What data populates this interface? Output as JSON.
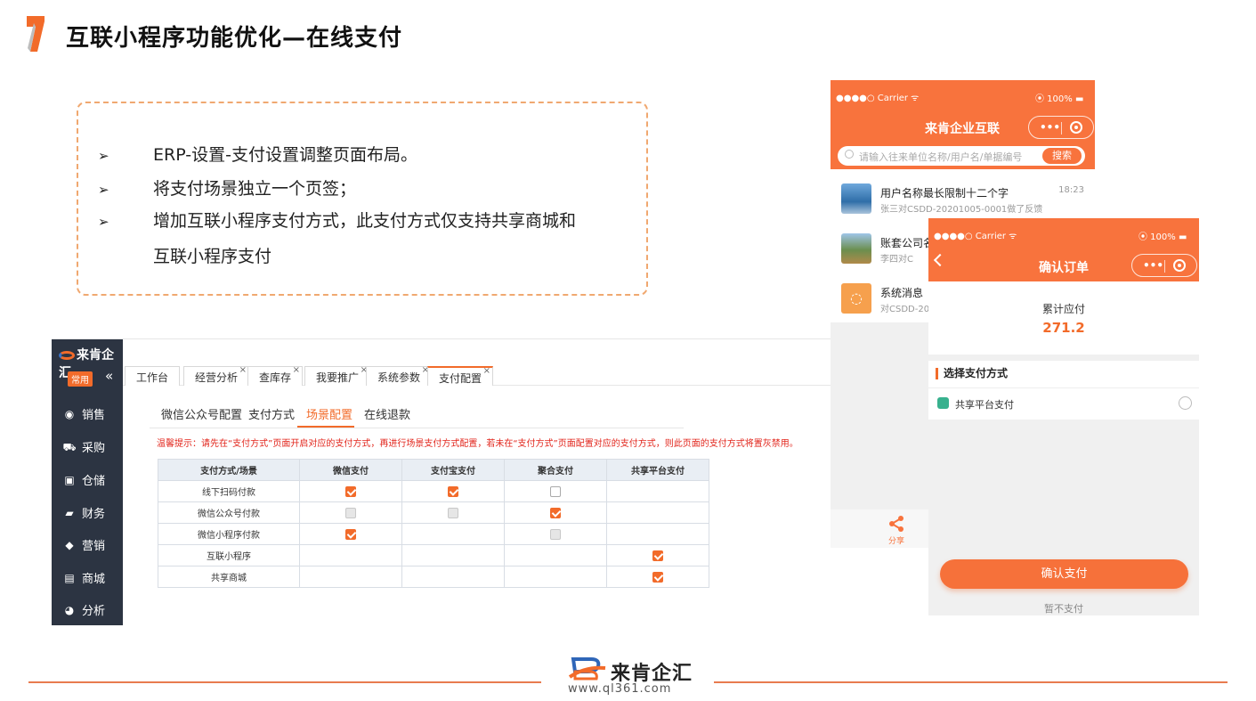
{
  "slide": {
    "title": "互联小程序功能优化—在线支付",
    "bullets": [
      "ERP-设置-支付设置调整页面布局。",
      "将支付场景独立一个页签；",
      "增加互联小程序支付方式，此支付方式仅支持共享商城和",
      "互联小程序支付"
    ],
    "bullet_marker": "➢"
  },
  "erp": {
    "logo": "来肯企汇",
    "common_badge": "常用",
    "collapse_glyph": "«",
    "menu": [
      "销售",
      "采购",
      "仓储",
      "财务",
      "营销",
      "商城",
      "分析"
    ],
    "page_tabs": [
      "工作台",
      "经营分析",
      "查库存",
      "我要推广",
      "系统参数",
      "支付配置"
    ],
    "active_page_tab": "支付配置",
    "close_glyph": "×",
    "sub_tabs": [
      "微信公众号配置",
      "支付方式",
      "场景配置",
      "在线退款"
    ],
    "active_sub_tab": "场景配置",
    "warning": "温馨提示：请先在“支付方式”页面开启对应的支付方式，再进行场景支付方式配置，若未在“支付方式”页面配置对应的支付方式，则此页面的支付方式将置灰禁用。",
    "table": {
      "headers": [
        "支付方式/场景",
        "微信支付",
        "支付宝支付",
        "聚合支付",
        "共享平台支付"
      ],
      "rows": [
        {
          "label": "线下扫码付款",
          "cells": [
            "on",
            "on",
            "off",
            "none"
          ]
        },
        {
          "label": "微信公众号付款",
          "cells": [
            "dis",
            "dis",
            "on",
            "none"
          ]
        },
        {
          "label": "微信小程序付款",
          "cells": [
            "on",
            "none",
            "dis",
            "none"
          ]
        },
        {
          "label": "互联小程序",
          "cells": [
            "none",
            "none",
            "none",
            "on"
          ]
        },
        {
          "label": "共享商城",
          "cells": [
            "none",
            "none",
            "none",
            "on"
          ]
        }
      ]
    }
  },
  "phone1": {
    "carrier": "●●●●○ Carrier ᯤ",
    "battery": "⦿ 100% ▬",
    "title": "来肯企业互联",
    "search_placeholder": "请输入往来单位名称/用户名/单据编号",
    "search_button": "搜索",
    "messages": [
      {
        "name": "用户名称最长限制十二个字",
        "sub": "张三对CSDD-20201005-0001做了反馈",
        "time": "18:23"
      },
      {
        "name": "账套公司名",
        "sub": "李四对C",
        "time": ""
      },
      {
        "name": "系统消息",
        "sub": "对CSDD-20",
        "time": ""
      }
    ],
    "share_label": "分享"
  },
  "phone2": {
    "carrier": "●●●●○ Carrier ᯤ",
    "battery": "⦿ 100% ▬",
    "title": "确认订单",
    "due_label": "累计应付",
    "due_amount": "271.2",
    "section_title": "选择支付方式",
    "option": "共享平台支付",
    "confirm_button": "确认支付",
    "skip": "暂不支付"
  },
  "footer": {
    "brand": "来肯企汇",
    "url": "www.ql361.com"
  },
  "colors": {
    "accent": "#f26b2a",
    "phone_header": "#f8733d",
    "sidebar": "#2c3442"
  }
}
